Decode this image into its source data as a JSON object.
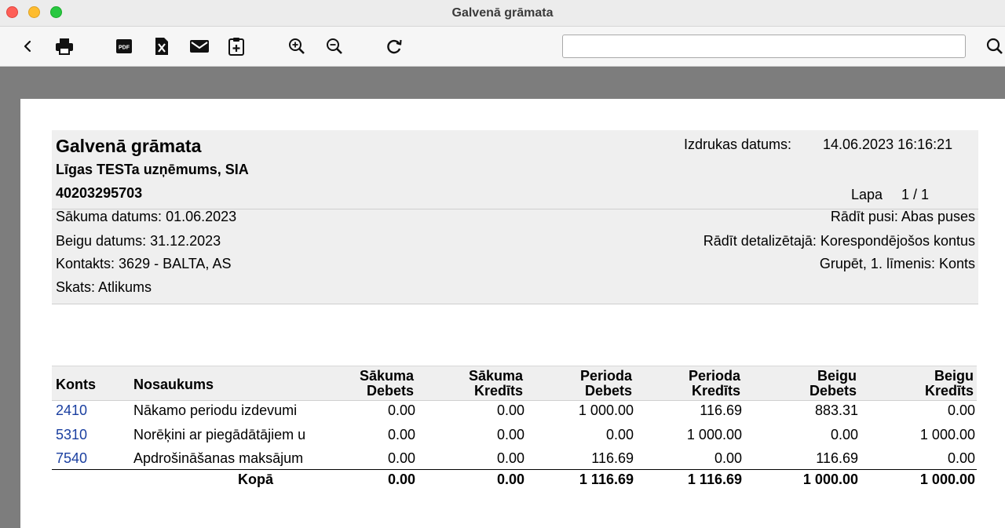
{
  "window": {
    "title": "Galvenā grāmata"
  },
  "toolbar": {
    "buttons": [
      {
        "icon": "chevron-left-icon"
      },
      {
        "icon": "print-icon"
      },
      {
        "icon": "pdf-icon"
      },
      {
        "icon": "excel-icon"
      },
      {
        "icon": "mail-icon"
      },
      {
        "icon": "clipboard-add-icon"
      },
      {
        "icon": "zoom-in-icon"
      },
      {
        "icon": "zoom-out-icon"
      },
      {
        "icon": "refresh-icon"
      }
    ],
    "search": {
      "value": "",
      "placeholder": ""
    },
    "pdf_label": "PDF"
  },
  "report": {
    "title": "Galvenā grāmata",
    "company": "Līgas TESTa uzņēmums, SIA",
    "reg_no": "40203295703",
    "print_date_label": "Izdrukas datums:",
    "print_date_value": "14.06.2023 16:16:21",
    "page_label": "Lapa",
    "page_value": "1 / 1",
    "start_date": "Sākuma datums: 01.06.2023",
    "end_date": "Beigu datums: 31.12.2023",
    "contact": "Kontakts: 3629 - BALTA, AS",
    "view": "Skats: Atlikums",
    "show_side": "Rādīt pusi: Abas puses",
    "show_detail": "Rādīt detalizētajā: Korespondējošos kontus",
    "group": "Grupēt, 1. līmenis: Konts"
  },
  "table": {
    "headers": {
      "account": "Konts",
      "name": "Nosaukums",
      "start_debit": [
        "Sākuma",
        "Debets"
      ],
      "start_credit": [
        "Sākuma",
        "Kredīts"
      ],
      "period_debit": [
        "Perioda",
        "Debets"
      ],
      "period_credit": [
        "Perioda",
        "Kredīts"
      ],
      "end_debit": [
        "Beigu",
        "Debets"
      ],
      "end_credit": [
        "Beigu",
        "Kredīts"
      ]
    },
    "rows": [
      {
        "account": "2410",
        "name": "Nākamo periodu izdevumi",
        "start_debit": "0.00",
        "start_credit": "0.00",
        "period_debit": "1 000.00",
        "period_credit": "116.69",
        "end_debit": "883.31",
        "end_credit": "0.00"
      },
      {
        "account": "5310",
        "name": "Norēķini ar piegādātājiem u",
        "start_debit": "0.00",
        "start_credit": "0.00",
        "period_debit": "0.00",
        "period_credit": "1 000.00",
        "end_debit": "0.00",
        "end_credit": "1 000.00"
      },
      {
        "account": "7540",
        "name": "Apdrošināšanas maksājum",
        "start_debit": "0.00",
        "start_credit": "0.00",
        "period_debit": "116.69",
        "period_credit": "0.00",
        "end_debit": "116.69",
        "end_credit": "0.00"
      }
    ],
    "total": {
      "label": "Kopā",
      "start_debit": "0.00",
      "start_credit": "0.00",
      "period_debit": "1 116.69",
      "period_credit": "1 116.69",
      "end_debit": "1 000.00",
      "end_credit": "1 000.00"
    }
  }
}
